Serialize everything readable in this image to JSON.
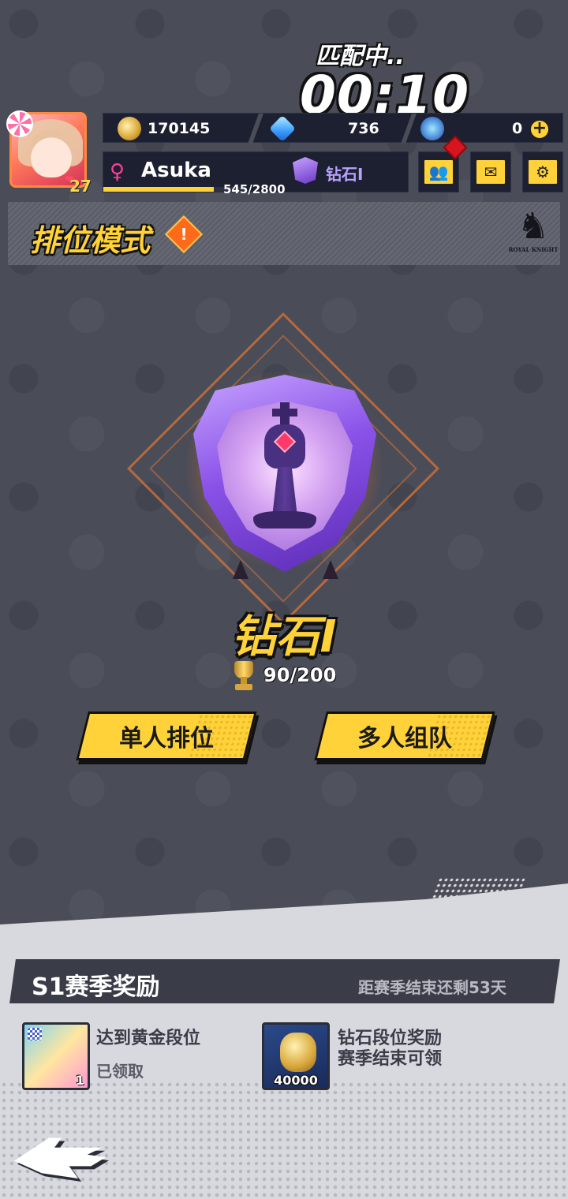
{
  "matchmaking": {
    "status": "匹配中..",
    "timer": "00:10"
  },
  "player": {
    "name": "Asuka",
    "gender_icon": "female-symbol-icon",
    "level": "27",
    "xp_text": "545/2800",
    "xp_progress": 0.1946,
    "rank": "钻石I"
  },
  "currencies": {
    "gold": "170145",
    "diamonds": "736",
    "tickets": "0"
  },
  "top_buttons": {
    "friends_icon": "friends-icon",
    "mail_icon": "mail-icon",
    "settings_icon": "gear-icon",
    "plus_label": "+"
  },
  "mode": {
    "title": "排位模式",
    "info_glyph": "!",
    "logo_text": "ROYAL KNIGHT"
  },
  "rank_display": {
    "title": "钻石I",
    "points": "90/200"
  },
  "actions": {
    "solo_label": "单人排位",
    "team_label": "多人组队"
  },
  "season": {
    "title": "S1赛季奖励",
    "remaining": "距赛季结束还剩53天",
    "rewards": [
      {
        "label": "达到黄金段位",
        "status": "已领取",
        "qty": "1"
      },
      {
        "label": "钻石段位奖励",
        "status": "赛季结束可领",
        "qty": "40000"
      }
    ]
  },
  "colors": {
    "accent_yellow": "#ffd23a",
    "background": "#4a4c58",
    "rank_purple": "#8a52e8",
    "alert_red": "#d8141e"
  }
}
